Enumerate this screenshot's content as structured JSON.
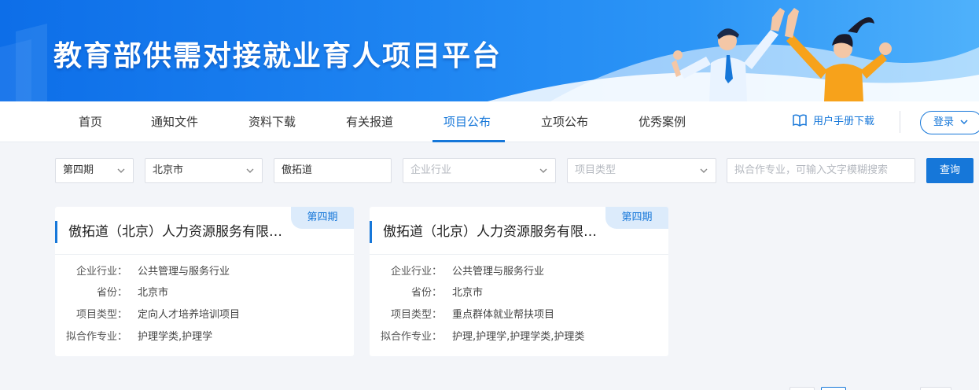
{
  "banner": {
    "title": "教育部供需对接就业育人项目平台"
  },
  "nav": {
    "items": [
      {
        "label": "首页"
      },
      {
        "label": "通知文件"
      },
      {
        "label": "资料下载"
      },
      {
        "label": "有关报道"
      },
      {
        "label": "项目公布"
      },
      {
        "label": "立项公布"
      },
      {
        "label": "优秀案例"
      }
    ],
    "active_index": 4,
    "manual_label": "用户手册下载",
    "login_label": "登录"
  },
  "filters": {
    "period": "第四期",
    "province": "北京市",
    "company": "傲拓道",
    "industry_placeholder": "企业行业",
    "type_placeholder": "项目类型",
    "major_placeholder": "拟合作专业，可输入文字模糊搜索",
    "search_label": "查询"
  },
  "labels": {
    "industry": "企业行业：",
    "province": "省份：",
    "type": "项目类型：",
    "major": "拟合作专业："
  },
  "cards": [
    {
      "badge": "第四期",
      "title": "傲拓道（北京）人力资源服务有限…",
      "industry": "公共管理与服务行业",
      "province": "北京市",
      "type": "定向人才培养培训项目",
      "major": "护理学类,护理学"
    },
    {
      "badge": "第四期",
      "title": "傲拓道（北京）人力资源服务有限…",
      "industry": "公共管理与服务行业",
      "province": "北京市",
      "type": "重点群体就业帮扶项目",
      "major": "护理,护理学,护理学类,护理类"
    }
  ],
  "colors": {
    "brand": "#1677d9",
    "badge_bg": "#dcebfb",
    "banner_start": "#0d6ee8",
    "banner_end": "#4fb1fb"
  }
}
